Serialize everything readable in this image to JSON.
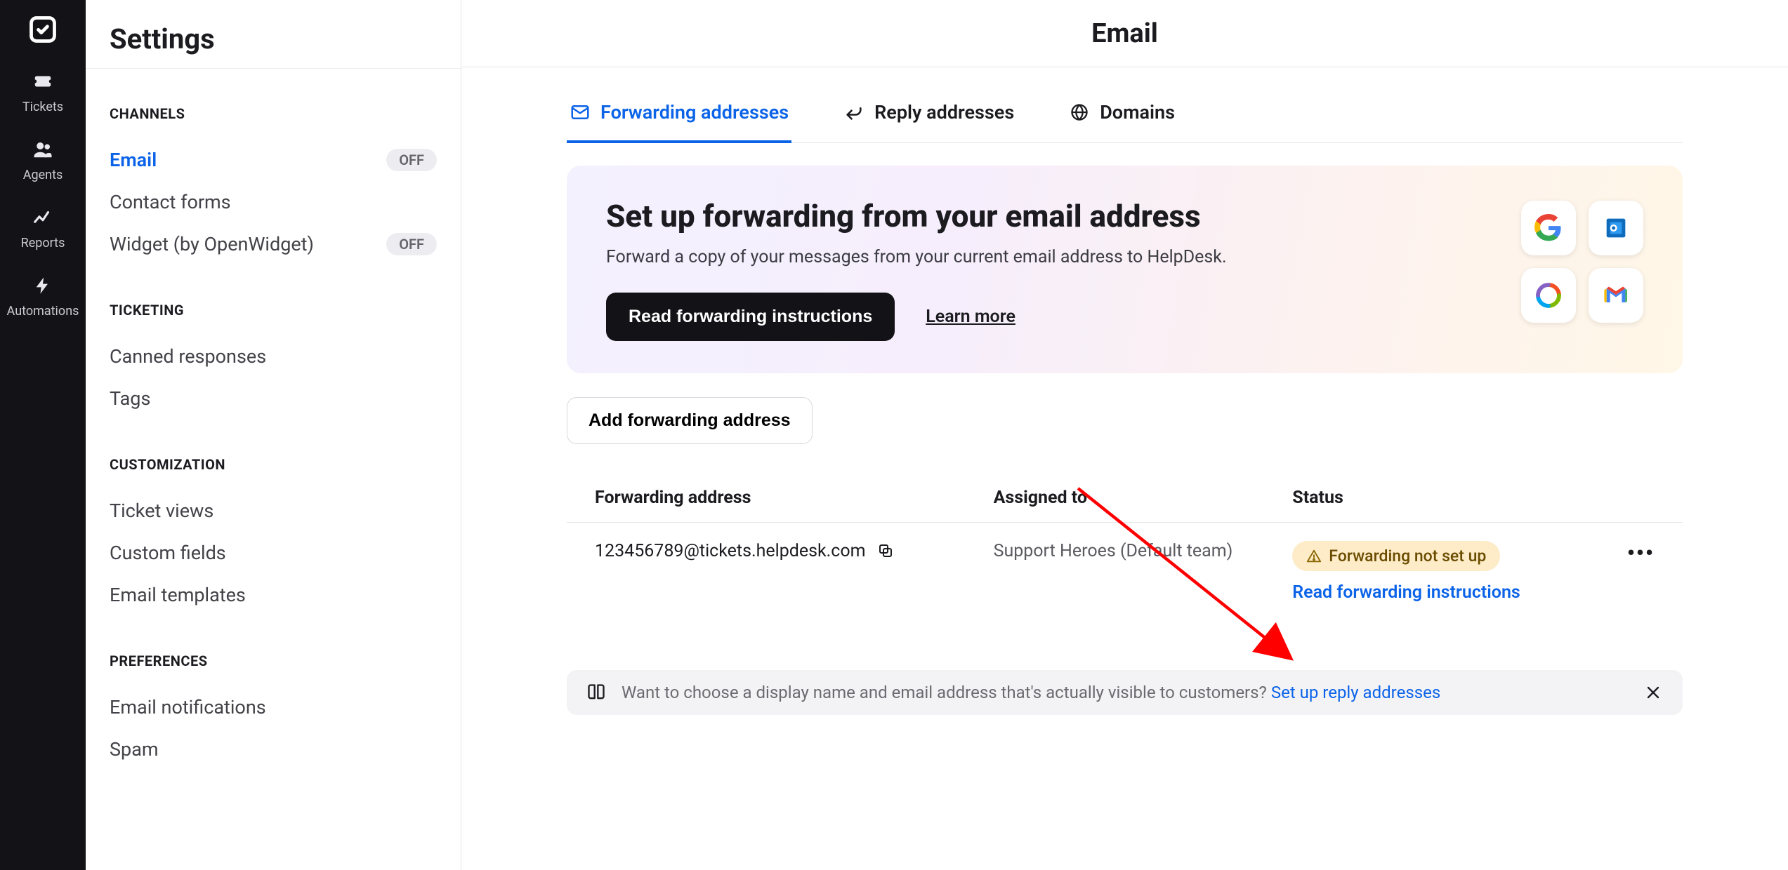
{
  "rail": {
    "items": [
      {
        "label": "Tickets"
      },
      {
        "label": "Agents"
      },
      {
        "label": "Reports"
      },
      {
        "label": "Automations"
      }
    ]
  },
  "settings": {
    "title": "Settings",
    "sections": [
      {
        "title": "CHANNELS",
        "items": [
          {
            "label": "Email",
            "active": true,
            "badge": "OFF"
          },
          {
            "label": "Contact forms"
          },
          {
            "label": "Widget (by OpenWidget)",
            "badge": "OFF"
          }
        ]
      },
      {
        "title": "TICKETING",
        "items": [
          {
            "label": "Canned responses"
          },
          {
            "label": "Tags"
          }
        ]
      },
      {
        "title": "CUSTOMIZATION",
        "items": [
          {
            "label": "Ticket views"
          },
          {
            "label": "Custom fields"
          },
          {
            "label": "Email templates"
          }
        ]
      },
      {
        "title": "PREFERENCES",
        "items": [
          {
            "label": "Email notifications"
          },
          {
            "label": "Spam"
          }
        ]
      }
    ]
  },
  "main": {
    "title": "Email",
    "tabs": [
      {
        "label": "Forwarding addresses"
      },
      {
        "label": "Reply addresses"
      },
      {
        "label": "Domains"
      }
    ],
    "banner": {
      "heading": "Set up forwarding from your email address",
      "subtext": "Forward a copy of your messages from your current email address to HelpDesk.",
      "primary_btn": "Read forwarding instructions",
      "learn_more": "Learn more"
    },
    "add_btn": "Add forwarding address",
    "table": {
      "headers": {
        "address": "Forwarding address",
        "assigned": "Assigned to",
        "status": "Status"
      },
      "rows": [
        {
          "address": "123456789@tickets.helpdesk.com",
          "assigned": "Support Heroes (Default team)",
          "status_label": "Forwarding not set up",
          "status_link": "Read forwarding instructions"
        }
      ]
    },
    "tip": {
      "text": "Want to choose a display name and email address that's actually visible to customers? ",
      "link": "Set up reply addresses"
    }
  }
}
